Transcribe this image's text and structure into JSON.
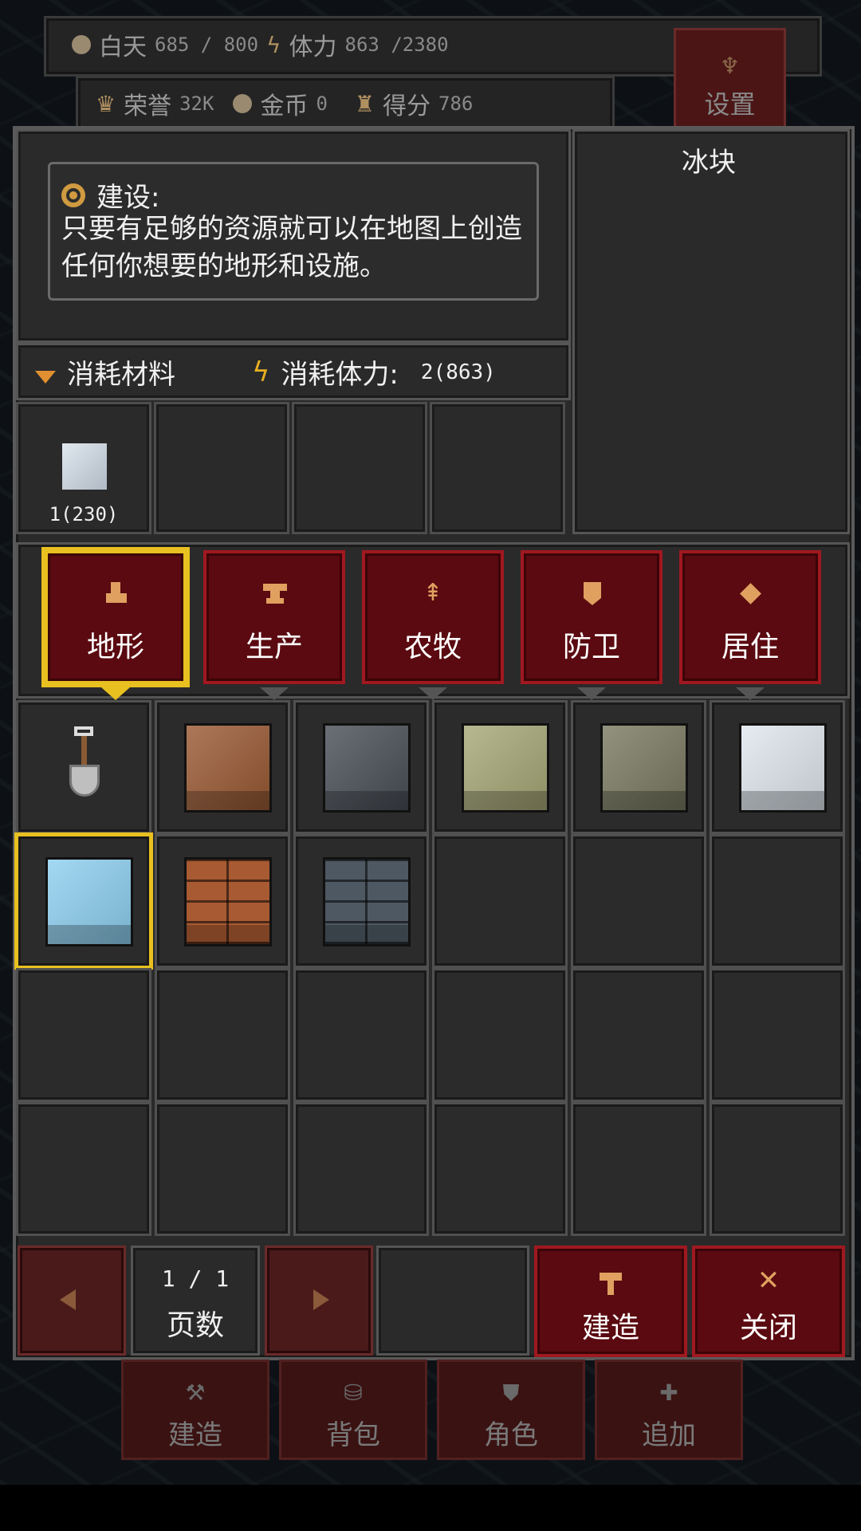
{
  "hud": {
    "day_label": "白天",
    "day_value": "685 / 800",
    "stamina_label": "体力",
    "stamina_value": "863 /2380",
    "honor_label": "荣誉",
    "honor_value": "32K",
    "gold_label": "金币",
    "gold_value": "0",
    "score_label": "得分",
    "score_value": "786",
    "settings_label": "设置"
  },
  "info": {
    "title": "建设:",
    "description": "只要有足够的资源就可以在地图上创造任何你想要的地形和设施。"
  },
  "cost": {
    "material_label": "消耗材料",
    "stamina_label": "消耗体力:",
    "stamina_value": "2(863)"
  },
  "materials": [
    {
      "icon": "ice-block-icon",
      "label": "1(230)"
    }
  ],
  "selected_item_name": "冰块",
  "categories": [
    {
      "label": "地形",
      "icon": "boot-icon",
      "active": true
    },
    {
      "label": "生产",
      "icon": "anvil-icon",
      "active": false
    },
    {
      "label": "农牧",
      "icon": "tree-icon",
      "active": false
    },
    {
      "label": "防卫",
      "icon": "shield-icon",
      "active": false
    },
    {
      "label": "居住",
      "icon": "diamond-icon",
      "active": false
    }
  ],
  "items": [
    {
      "name": "shovel-icon",
      "color": ""
    },
    {
      "name": "dirt-block-icon",
      "color": "#9a5a34"
    },
    {
      "name": "stone-block-icon",
      "color": "#4a5058"
    },
    {
      "name": "sand-block-icon",
      "color": "#a8a878"
    },
    {
      "name": "mossy-block-icon",
      "color": "#7a7a62"
    },
    {
      "name": "snow-block-icon",
      "color": "#dfe7ee"
    },
    {
      "name": "ice-block-icon",
      "color": "#8fd0f0"
    },
    {
      "name": "brick-block-icon",
      "color": "#a85a32"
    },
    {
      "name": "stone-brick-block-icon",
      "color": "#4e5862"
    }
  ],
  "pagination": {
    "prev_icon": "arrow-left-icon",
    "next_icon": "arrow-right-icon",
    "page_value": "1 / 1",
    "page_label": "页数"
  },
  "actions": {
    "build_label": "建造",
    "close_label": "关闭"
  },
  "dock": {
    "build_label": "建造",
    "bag_label": "背包",
    "character_label": "角色",
    "add_label": "追加"
  },
  "colors": {
    "accent_gold": "#e8c020",
    "button_red": "#5a0a10",
    "panel_gray": "#2a2a2a"
  }
}
